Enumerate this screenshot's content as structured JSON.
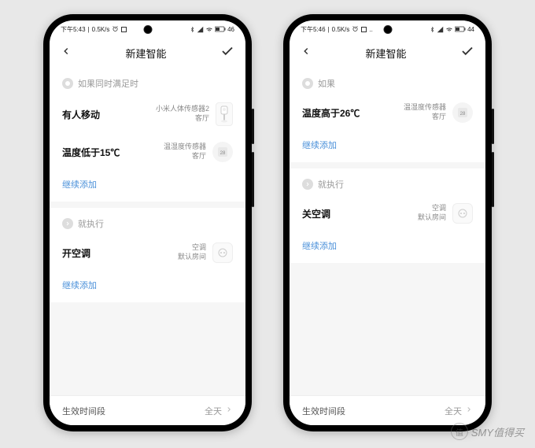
{
  "watermark": {
    "badge": "值",
    "text": "SMY值得买"
  },
  "phones": [
    {
      "status": {
        "time": "下午5:43",
        "speed": "0.5K/s",
        "battery": "46"
      },
      "header": {
        "title": "新建智能"
      },
      "condition_section": {
        "label": "如果同时满足时",
        "items": [
          {
            "title": "有人移动",
            "device": "小米人体传感器2",
            "room": "客厅",
            "icon": "motion"
          },
          {
            "title": "温度低于15℃",
            "device": "温湿度传感器",
            "room": "客厅",
            "icon": "therm"
          }
        ],
        "add": "继续添加"
      },
      "action_section": {
        "label": "就执行",
        "items": [
          {
            "title": "开空调",
            "device": "空调",
            "room": "默认房间",
            "icon": "plug"
          }
        ],
        "add": "继续添加"
      },
      "footer": {
        "label": "生效时间段",
        "value": "全天"
      }
    },
    {
      "status": {
        "time": "下午5:46",
        "speed": "0.5K/s",
        "battery": "44",
        "dots": ".."
      },
      "header": {
        "title": "新建智能"
      },
      "condition_section": {
        "label": "如果",
        "items": [
          {
            "title": "温度高于26℃",
            "device": "温湿度传感器",
            "room": "客厅",
            "icon": "therm"
          }
        ],
        "add": "继续添加"
      },
      "action_section": {
        "label": "就执行",
        "items": [
          {
            "title": "关空调",
            "device": "空调",
            "room": "默认房间",
            "icon": "plug"
          }
        ],
        "add": "继续添加"
      },
      "footer": {
        "label": "生效时间段",
        "value": "全天"
      }
    }
  ]
}
